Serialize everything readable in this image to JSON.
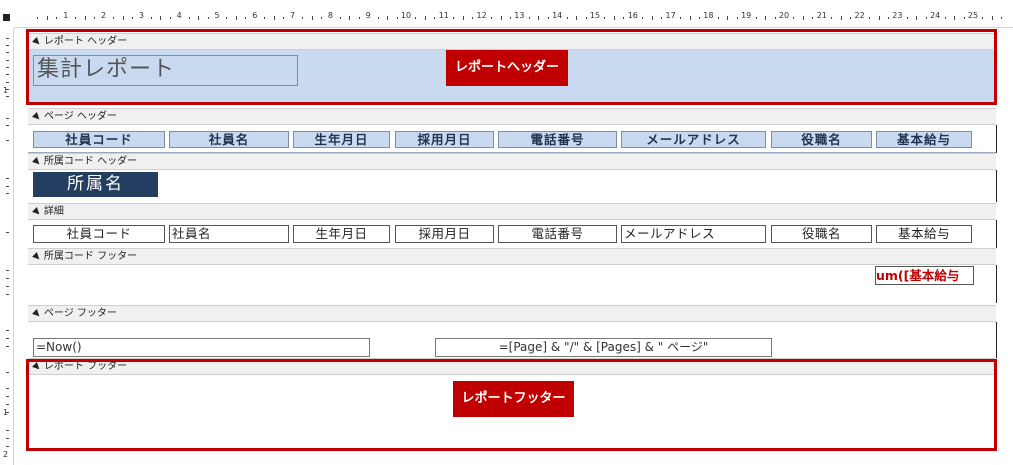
{
  "ruler": {
    "numbers": [
      "1",
      "2",
      "3",
      "4",
      "5",
      "6",
      "7",
      "8",
      "9",
      "10",
      "11",
      "12",
      "13",
      "14",
      "15",
      "16",
      "17",
      "18",
      "19",
      "20",
      "21",
      "22",
      "23",
      "24",
      "25"
    ],
    "vertical_numbers": [
      "1",
      "1",
      "2"
    ]
  },
  "sections": {
    "report_header": "レポート ヘッダー",
    "page_header": "ページ ヘッダー",
    "group_header": "所属コード ヘッダー",
    "detail": "詳細",
    "group_footer": "所属コード フッター",
    "page_footer": "ページ フッター",
    "report_footer": "レポート フッター"
  },
  "report_header": {
    "title": "集計レポート"
  },
  "page_header": {
    "labels": [
      "社員コード",
      "社員名",
      "生年月日",
      "採用月日",
      "電話番号",
      "メールアドレス",
      "役職名",
      "基本給与"
    ]
  },
  "group_header": {
    "dept_label": "所属名"
  },
  "detail": {
    "fields": [
      "社員コード",
      "社員名",
      "生年月日",
      "採用月日",
      "電話番号",
      "メールアドレス",
      "役職名",
      "基本給与"
    ]
  },
  "group_footer": {
    "sum_expression": "um([基本給与"
  },
  "page_footer": {
    "now_expression": "=Now()",
    "page_expression": "=[Page] & \"/\" & [Pages] & \" ページ\""
  },
  "annotations": {
    "header_callout": "レポートヘッダー",
    "footer_callout": "レポートフッター"
  },
  "colors": {
    "header_fill": "#c9daf0",
    "dept_fill": "#243e61",
    "annotation_red": "#c00000"
  }
}
